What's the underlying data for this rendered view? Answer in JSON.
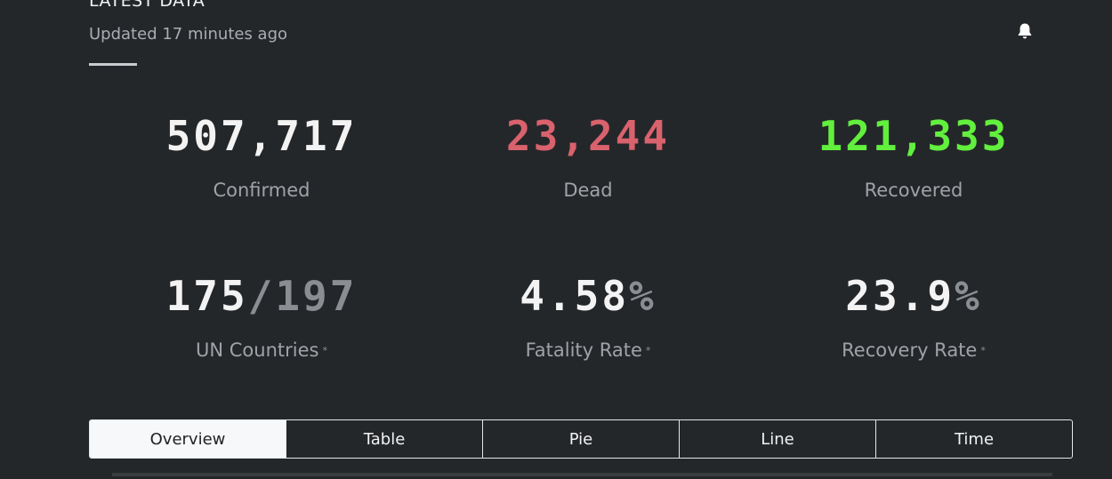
{
  "header": {
    "title": "LATEST DATA",
    "updated": "Updated 17 minutes ago",
    "bell_icon": "bell-icon"
  },
  "stats": {
    "confirmed": {
      "value": "507,717",
      "label": "Confirmed",
      "color": "#f3f3f3"
    },
    "dead": {
      "value": "23,244",
      "label": "Dead",
      "color": "#d9626d"
    },
    "recovered": {
      "value": "121,333",
      "label": "Recovered",
      "color": "#62ef3e"
    },
    "un_countries": {
      "value": "175",
      "total": "/197",
      "label": "UN Countries",
      "note": "*"
    },
    "fatality_rate": {
      "value": "4.58",
      "unit": "%",
      "label": "Fatality Rate",
      "note": "*"
    },
    "recovery_rate": {
      "value": "23.9",
      "unit": "%",
      "label": "Recovery Rate",
      "note": "*"
    }
  },
  "tabs": [
    {
      "label": "Overview",
      "active": true
    },
    {
      "label": "Table",
      "active": false
    },
    {
      "label": "Pie",
      "active": false
    },
    {
      "label": "Line",
      "active": false
    },
    {
      "label": "Time",
      "active": false
    }
  ]
}
